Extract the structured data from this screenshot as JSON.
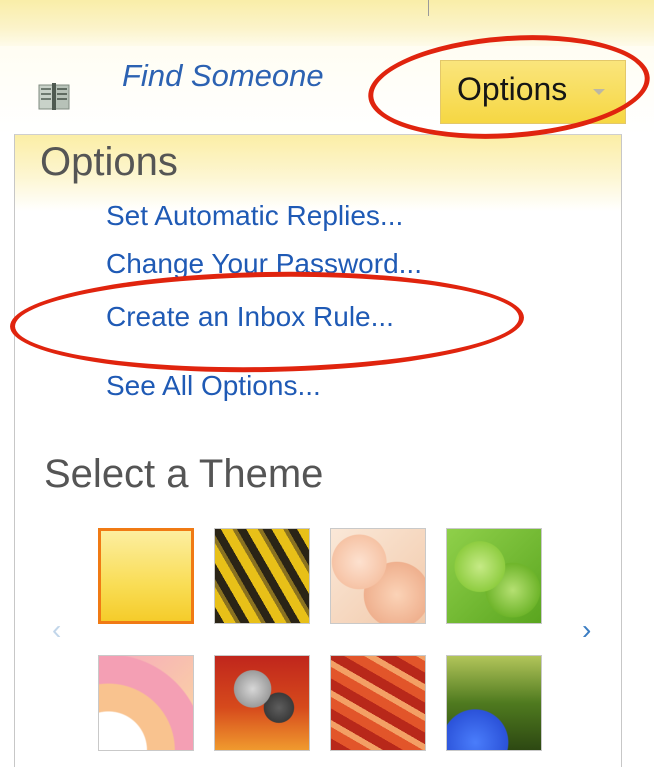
{
  "toolbar": {
    "find_someone_label": "Find Someone",
    "options_button_label": "Options"
  },
  "options_menu": {
    "title": "Options",
    "items": [
      {
        "label": "Set Automatic Replies..."
      },
      {
        "label": "Change Your Password..."
      },
      {
        "label": "Create an Inbox Rule..."
      },
      {
        "label": "See All Options..."
      }
    ]
  },
  "themes": {
    "title": "Select a Theme",
    "prev_arrow": "‹",
    "next_arrow": "›",
    "selected_index": 0
  },
  "colors": {
    "link": "#1f5ab5",
    "heading": "#555555",
    "selected_theme_border": "#f07a14",
    "annotation": "#e0240e",
    "button_bg": "#f6d743"
  }
}
